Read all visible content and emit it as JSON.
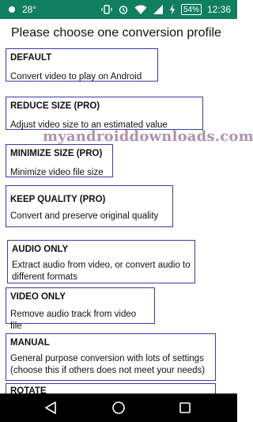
{
  "status_bar": {
    "temperature": "28°",
    "battery": "54%",
    "time": "12:36",
    "icons": [
      "weather-icon",
      "vibrate-icon",
      "alarm-icon",
      "wifi-icon",
      "signal-icon",
      "battery-charging-icon"
    ]
  },
  "screen": {
    "heading": "Please choose one conversion profile"
  },
  "profiles": [
    {
      "title": "DEFAULT",
      "description": "Convert video to play on Android"
    },
    {
      "title": "REDUCE SIZE (PRO)",
      "description": "Adjust video size to an estimated value"
    },
    {
      "title": "MINIMIZE SIZE (PRO)",
      "description": "Minimize video file size"
    },
    {
      "title": "KEEP QUALITY (PRO)",
      "description": "Convert and preserve original quality"
    },
    {
      "title": "AUDIO ONLY",
      "description": "Extract audio from video, or convert audio to different formats"
    },
    {
      "title": "VIDEO ONLY",
      "description": "Remove audio track from video file"
    },
    {
      "title": "MANUAL",
      "description": "General purpose conversion with lots of settings (choose this if others does not meet your needs)"
    },
    {
      "title": "ROTATE"
    }
  ],
  "watermark": "myandroiddownloads.com",
  "navigation": [
    "back-icon",
    "home-icon",
    "recents-icon"
  ],
  "colors": {
    "status_bar": "#0f7f5f",
    "card_border": "#3b3ba5",
    "nav_bar": "#000000"
  }
}
